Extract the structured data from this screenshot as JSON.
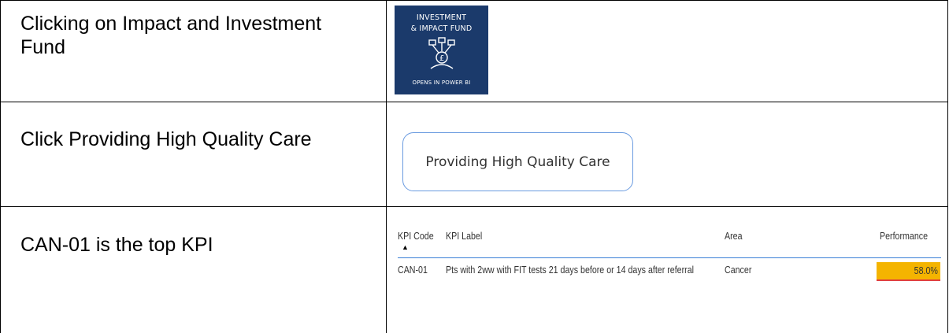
{
  "steps": [
    {
      "line1": "Clicking on Impact and Investment",
      "line2": "Fund"
    },
    {
      "line1": "Click Providing High Quality Care"
    },
    {
      "line1": "CAN-01 is the top KPI"
    }
  ],
  "tile": {
    "title_line1": "INVESTMENT",
    "title_line2": "& IMPACT FUND",
    "footer": "OPENS IN POWER BI",
    "icon": "pound-network-icon",
    "background": "#1b3a6b"
  },
  "button": {
    "label": "Providing High Quality Care"
  },
  "kpi_table": {
    "headers": {
      "code": "KPI Code",
      "label": "KPI Label",
      "area": "Area",
      "performance": "Performance"
    },
    "sort_indicator": "▲",
    "rows": [
      {
        "code": "CAN-01",
        "label": "Pts with 2ww with FIT tests 21 days before or 14 days after referral",
        "area": "Cancer",
        "performance": "58.0%"
      }
    ],
    "highlight_color": "#f4b400"
  }
}
